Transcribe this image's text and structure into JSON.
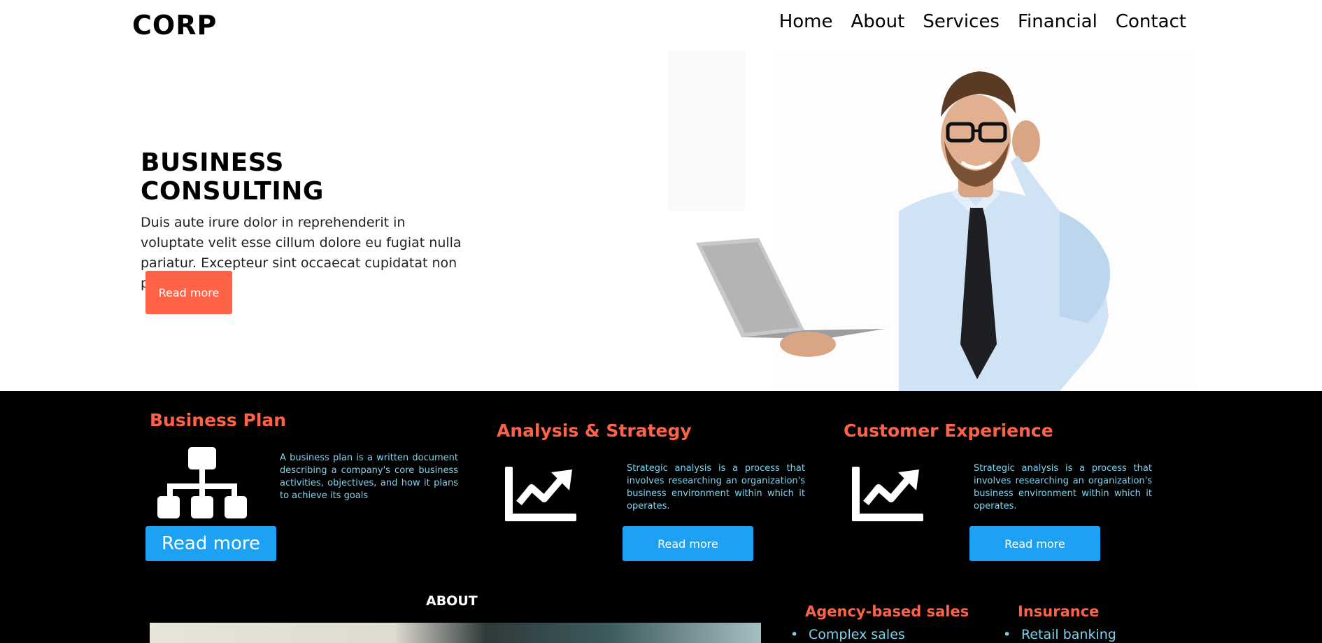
{
  "header": {
    "logo": "CORP",
    "nav": [
      "Home",
      "About",
      "Services",
      "Financial",
      "Contact"
    ]
  },
  "hero": {
    "title": "BUSINESS CONSULTING",
    "description": "Duis aute irure dolor in reprehenderit in voluptate velit esse cillum dolore eu fugiat nulla pariatur. Excepteur sint occaecat cupidatat non proident.",
    "button": "Read more"
  },
  "services": [
    {
      "title": "Business Plan",
      "icon": "org-chart-icon",
      "description": "A business plan is a written document describing a company's core business activities, objectives, and how it plans to achieve its goals",
      "button": "Read more"
    },
    {
      "title": "Analysis & Strategy",
      "icon": "trending-chart-icon",
      "description": "Strategic analysis is a process that involves researching an organization's business environment within which it operates.",
      "button": "Read more"
    },
    {
      "title": "Customer Experience",
      "icon": "trending-chart-icon",
      "description": "Strategic analysis is a process that involves researching an organization's business environment within which it operates.",
      "button": "Read more"
    }
  ],
  "about": {
    "title": "ABOUT"
  },
  "columns": [
    {
      "title": "Agency-based sales",
      "items": [
        "Complex sales"
      ]
    },
    {
      "title": "Insurance",
      "items": [
        "Retail banking"
      ]
    }
  ],
  "colors": {
    "accent": "#ff6347",
    "button_blue": "#1da1f2",
    "text_cyan": "#7fd3f0",
    "dark_bg": "#000000"
  }
}
